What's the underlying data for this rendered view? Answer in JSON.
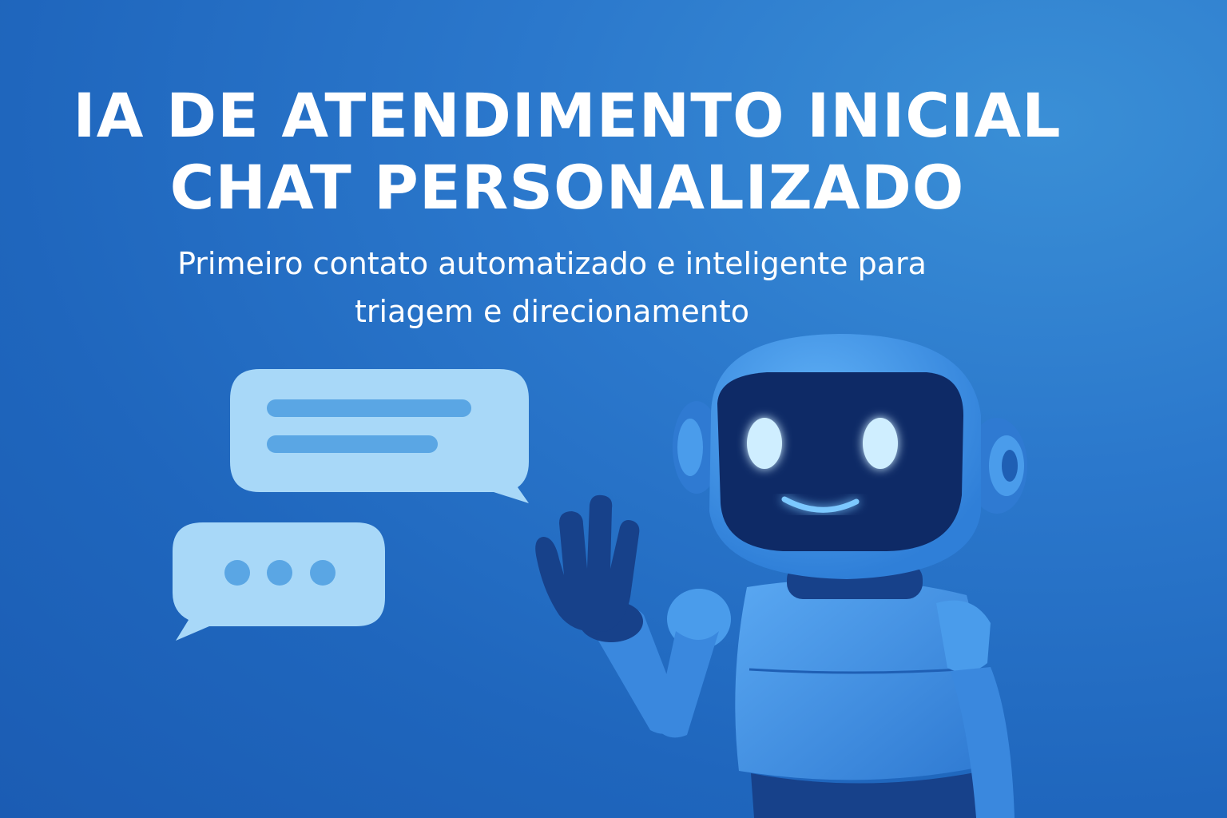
{
  "hero": {
    "title_line1": "IA DE ATENDIMENTO INICIAL",
    "title_line2": "CHAT PERSONALIZADO",
    "subtitle_line1": "Primeiro contato automatizado e inteligente para",
    "subtitle_line2": "triagem e direcionamento"
  },
  "colors": {
    "background": "#2270c4",
    "bubble": "#a8d8f8",
    "bubble_detail": "#5aa6e4",
    "robot_body": "#3f8fe6",
    "robot_dark": "#123a7c",
    "robot_glow": "#cfeeff"
  },
  "icons": [
    "message-bubble-icon",
    "typing-bubble-icon",
    "robot-mascot-icon"
  ]
}
